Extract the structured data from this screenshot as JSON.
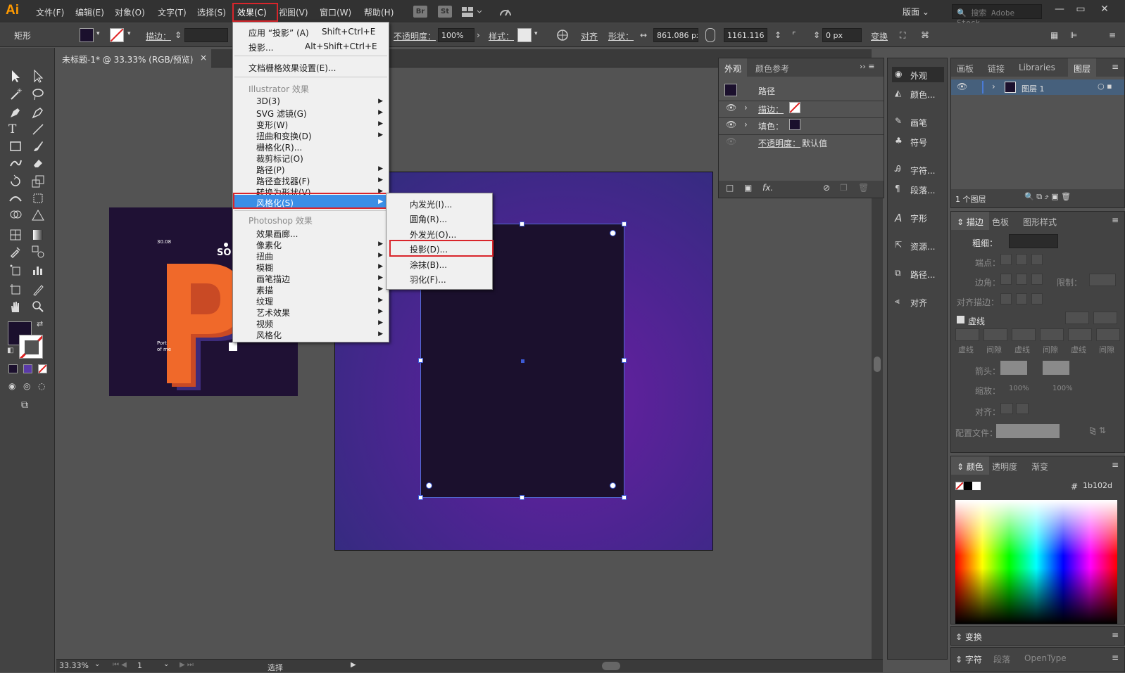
{
  "app": {
    "logo": "Ai"
  },
  "menubar": {
    "items": [
      "文件(F)",
      "编辑(E)",
      "对象(O)",
      "文字(T)",
      "选择(S)",
      "效果(C)",
      "视图(V)",
      "窗口(W)",
      "帮助(H)"
    ],
    "br": "Br",
    "st": "St",
    "workspace": "版面",
    "stock_placeholder": "搜索 Adobe Stock"
  },
  "control": {
    "object_type": "矩形",
    "stroke_label": "描边：",
    "opacity_label": "不透明度：",
    "opacity_value": "100%",
    "style_label": "样式：",
    "align_label": "对齐",
    "shape_label": "形状：",
    "width_value": "861.086 px",
    "height_value": "1161.116 px",
    "corner_value": "0 px",
    "transform_label": "变换"
  },
  "document": {
    "tab_title": "未标题-1* @ 33.33% (RGB/预览)",
    "close": "×"
  },
  "poster": {
    "date": "30.08",
    "big_text": "SO",
    "caption_line1": "Port",
    "caption_line2": "of me"
  },
  "effect_menu": {
    "apply_label": "应用 “投影” (A)",
    "apply_shortcut": "Shift+Ctrl+E",
    "drop_label": "投影...",
    "drop_shortcut": "Alt+Shift+Ctrl+E",
    "doc_raster": "文档栅格效果设置(E)...",
    "illustrator_header": "Illustrator 效果",
    "illustrator_items": [
      "3D(3)",
      "SVG 滤镜(G)",
      "变形(W)",
      "扭曲和变换(D)",
      "栅格化(R)...",
      "裁剪标记(O)",
      "路径(P)",
      "路径查找器(F)",
      "转换为形状(V)",
      "风格化(S)"
    ],
    "photoshop_header": "Photoshop 效果",
    "photoshop_items": [
      "效果画廊...",
      "像素化",
      "扭曲",
      "模糊",
      "画笔描边",
      "素描",
      "纹理",
      "艺术效果",
      "视频",
      "风格化"
    ]
  },
  "stylize_submenu": {
    "items": [
      "内发光(I)...",
      "圆角(R)...",
      "外发光(O)...",
      "投影(D)...",
      "涂抹(B)...",
      "羽化(F)..."
    ]
  },
  "appearance_panel": {
    "tabs": [
      "外观",
      "颜色参考"
    ],
    "path_label": "路径",
    "stroke_label": "描边：",
    "fill_label": "填色：",
    "opacity_label": "不透明度：",
    "opacity_value": "默认值"
  },
  "dock": {
    "items": [
      "外观",
      "颜色...",
      "画笔",
      "符号",
      "字符...",
      "段落...",
      "字形",
      "资源...",
      "路径...",
      "对齐"
    ]
  },
  "layers_panel": {
    "tabs": [
      "画板",
      "链接",
      "Libraries",
      "图层"
    ],
    "layer_name": "图层 1",
    "count": "1 个图层"
  },
  "stroke_panel": {
    "tabs": [
      "描边",
      "色板",
      "图形样式"
    ],
    "weight_label": "粗细：",
    "cap_label": "端点：",
    "corner_label": "边角：",
    "limit_label": "限制：",
    "align_label": "对齐描边：",
    "dashed_label": "虚线",
    "dash_labels": [
      "虚线",
      "间隙",
      "虚线",
      "间隙",
      "虚线",
      "间隙"
    ],
    "arrow_label": "箭头：",
    "scale_label": "缩放：",
    "scale_value1": "100%",
    "scale_value2": "100%",
    "align2_label": "对齐：",
    "profile_label": "配置文件："
  },
  "color_panel": {
    "tabs": [
      "颜色",
      "透明度",
      "渐变"
    ],
    "hash": "#",
    "hex": "1b102d"
  },
  "bottom_tabs": {
    "transform": "变换",
    "char_tabs": [
      "字符",
      "段落",
      "OpenType"
    ]
  },
  "status": {
    "zoom": "33.33%",
    "page": "1",
    "tool": "选择"
  },
  "colors": {
    "fill": "#1b102d",
    "accent_red": "#d9252b",
    "menu_highlight": "#3a8ee6"
  }
}
